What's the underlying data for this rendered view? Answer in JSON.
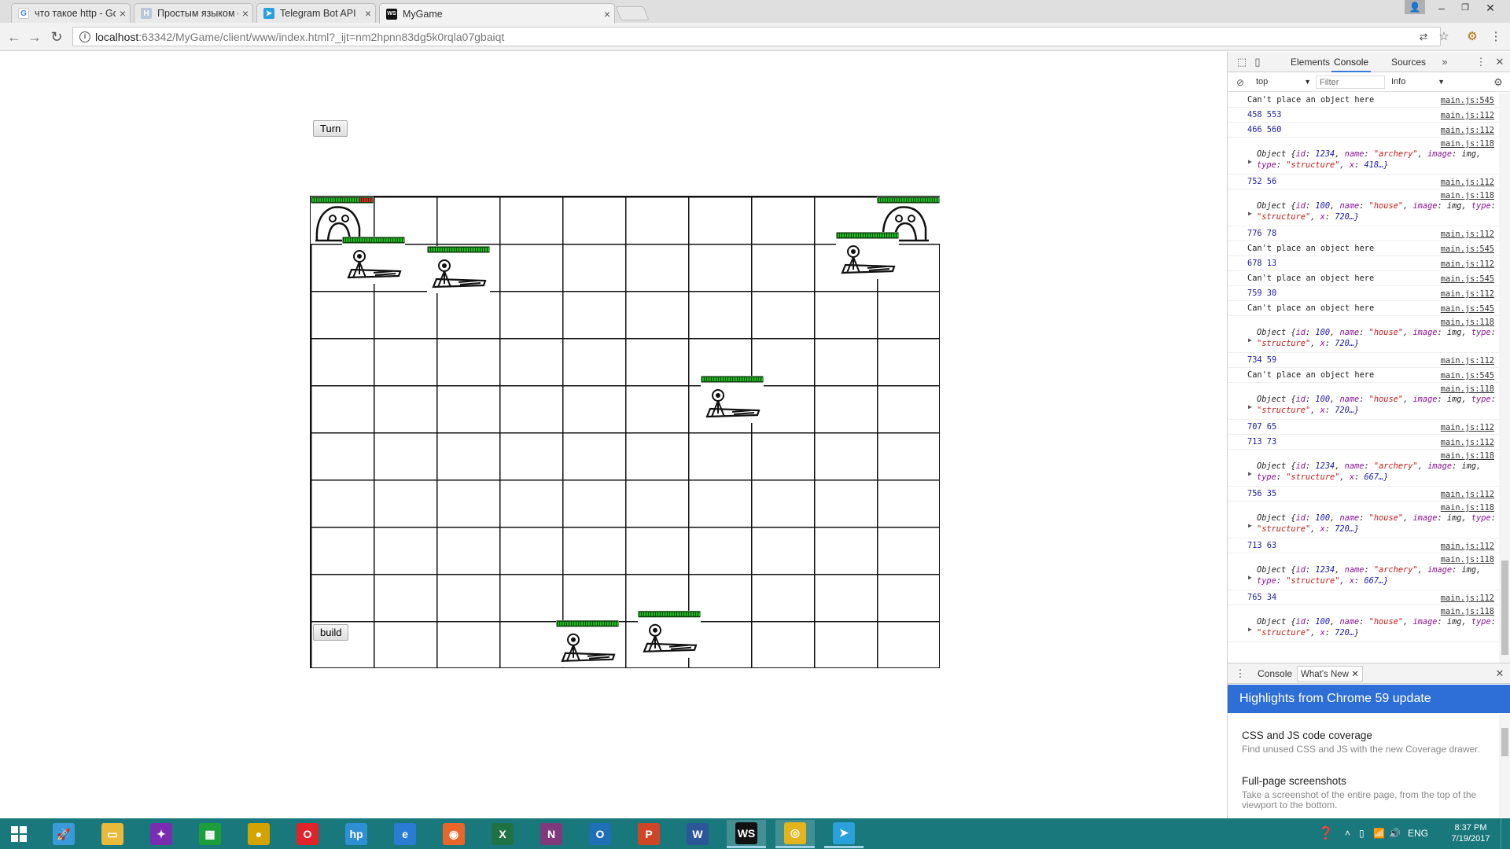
{
  "browser": {
    "tabs": [
      {
        "title": "что такое http - Google",
        "favicon": "google-icon"
      },
      {
        "title": "Простым языком об HT",
        "favicon": "page-icon"
      },
      {
        "title": "Telegram Bot API",
        "favicon": "telegram-icon"
      },
      {
        "title": "MyGame",
        "favicon": "webstorm-icon",
        "active": true
      }
    ],
    "url_host": "localhost",
    "url_path": ":63342/MyGame/client/www/index.html?_ijt=nm2hpnn83dg5k0rqla07gbaiqt"
  },
  "game": {
    "turn_label": "Turn",
    "build_label": "build",
    "grid": {
      "columns": 10,
      "rows": 10
    },
    "structures": [
      {
        "name": "archery",
        "col": 0,
        "row": 0,
        "health": 0.78
      },
      {
        "name": "archery",
        "col": 9,
        "row": 0,
        "health": 1.0
      },
      {
        "name": "house",
        "col": 0.5,
        "row": 0.85,
        "health": 1.0
      },
      {
        "name": "house",
        "col": 1.85,
        "row": 1.05,
        "health": 1.0
      },
      {
        "name": "house",
        "col": 8.35,
        "row": 0.75,
        "health": 1.0
      },
      {
        "name": "house",
        "col": 6.2,
        "row": 3.8,
        "health": 1.0
      },
      {
        "name": "house",
        "col": 3.9,
        "row": 8.98,
        "health": 1.0
      },
      {
        "name": "house",
        "col": 5.2,
        "row": 8.78,
        "health": 1.0
      }
    ]
  },
  "devtools": {
    "tabs": [
      "Elements",
      "Console",
      "Sources"
    ],
    "active_tab": "Console",
    "context": "top",
    "filter_placeholder": "Filter",
    "level": "Info",
    "console": [
      {
        "type": "plain",
        "text": "Can't place an object here",
        "src": "main.js:545"
      },
      {
        "type": "num",
        "text": "458 553",
        "src": "main.js:112"
      },
      {
        "type": "num",
        "text": "466 560",
        "src": "main.js:112"
      },
      {
        "type": "obj",
        "id": "1234",
        "name": "\"archery\"",
        "x": "418…}",
        "src": "main.js:118"
      },
      {
        "type": "num",
        "text": "752 56",
        "src": "main.js:112"
      },
      {
        "type": "obj",
        "id": "100",
        "name": "\"house\"",
        "x": "720…}",
        "src": "main.js:118"
      },
      {
        "type": "num",
        "text": "776 78",
        "src": "main.js:112"
      },
      {
        "type": "plain",
        "text": "Can't place an object here",
        "src": "main.js:545"
      },
      {
        "type": "num",
        "text": "678 13",
        "src": "main.js:112"
      },
      {
        "type": "plain",
        "text": "Can't place an object here",
        "src": "main.js:545"
      },
      {
        "type": "num",
        "text": "759 30",
        "src": "main.js:112"
      },
      {
        "type": "plain",
        "text": "Can't place an object here",
        "src": "main.js:545"
      },
      {
        "type": "obj",
        "id": "100",
        "name": "\"house\"",
        "x": "720…}",
        "src": "main.js:118"
      },
      {
        "type": "num",
        "text": "734 59",
        "src": "main.js:112"
      },
      {
        "type": "plain",
        "text": "Can't place an object here",
        "src": "main.js:545"
      },
      {
        "type": "obj",
        "id": "100",
        "name": "\"house\"",
        "x": "720…}",
        "src": "main.js:118"
      },
      {
        "type": "num",
        "text": "707 65",
        "src": "main.js:112"
      },
      {
        "type": "num",
        "text": "713 73",
        "src": "main.js:112"
      },
      {
        "type": "obj",
        "id": "1234",
        "name": "\"archery\"",
        "x": "667…}",
        "src": "main.js:118"
      },
      {
        "type": "num",
        "text": "756 35",
        "src": "main.js:112"
      },
      {
        "type": "obj",
        "id": "100",
        "name": "\"house\"",
        "x": "720…}",
        "src": "main.js:118"
      },
      {
        "type": "num",
        "text": "713 63",
        "src": "main.js:112"
      },
      {
        "type": "obj",
        "id": "1234",
        "name": "\"archery\"",
        "x": "667…}",
        "src": "main.js:118"
      },
      {
        "type": "num",
        "text": "765 34",
        "src": "main.js:112"
      },
      {
        "type": "obj",
        "id": "100",
        "name": "\"house\"",
        "x": "720…}",
        "src": "main.js:118"
      }
    ],
    "drawer_tabs": [
      "Console",
      "What's New"
    ],
    "highlight_title": "Highlights from Chrome 59 update",
    "whats_new": [
      {
        "title": "CSS and JS code coverage",
        "desc": "Find unused CSS and JS with the new Coverage drawer."
      },
      {
        "title": "Full-page screenshots",
        "desc": "Take a screenshot of the entire page, from the top of the viewport to the bottom."
      }
    ]
  },
  "taskbar": {
    "lang": "ENG",
    "time": "8:37 PM",
    "date": "7/19/2017",
    "apps": [
      {
        "name": "rocket-icon",
        "color": "#3a9ad9",
        "glyph": "🚀"
      },
      {
        "name": "file-explorer-icon",
        "color": "#e8b93a",
        "glyph": "▭"
      },
      {
        "name": "paint-app-icon",
        "color": "#7a2db0",
        "glyph": "✦"
      },
      {
        "name": "store-icon",
        "color": "#1e9e3a",
        "glyph": "▦"
      },
      {
        "name": "media-player-icon",
        "color": "#d4a300",
        "glyph": "●"
      },
      {
        "name": "opera-icon",
        "color": "#e0242a",
        "glyph": "O"
      },
      {
        "name": "hp-icon",
        "color": "#2f8fd3",
        "glyph": "hp"
      },
      {
        "name": "internet-explorer-icon",
        "color": "#2a7bd4",
        "glyph": "e"
      },
      {
        "name": "firefox-icon",
        "color": "#e8662a",
        "glyph": "◉"
      },
      {
        "name": "excel-icon",
        "color": "#1f7244",
        "glyph": "X"
      },
      {
        "name": "onenote-icon",
        "color": "#80397b",
        "glyph": "N"
      },
      {
        "name": "outlook-icon",
        "color": "#1f6fb7",
        "glyph": "O"
      },
      {
        "name": "powerpoint-icon",
        "color": "#d04525",
        "glyph": "P"
      },
      {
        "name": "word-icon",
        "color": "#2b579a",
        "glyph": "W"
      },
      {
        "name": "webstorm-icon",
        "color": "#111",
        "glyph": "WS"
      },
      {
        "name": "chrome-icon",
        "color": "#e4b41c",
        "glyph": "◎"
      },
      {
        "name": "telegram-icon",
        "color": "#2aa1da",
        "glyph": "➤"
      }
    ]
  }
}
